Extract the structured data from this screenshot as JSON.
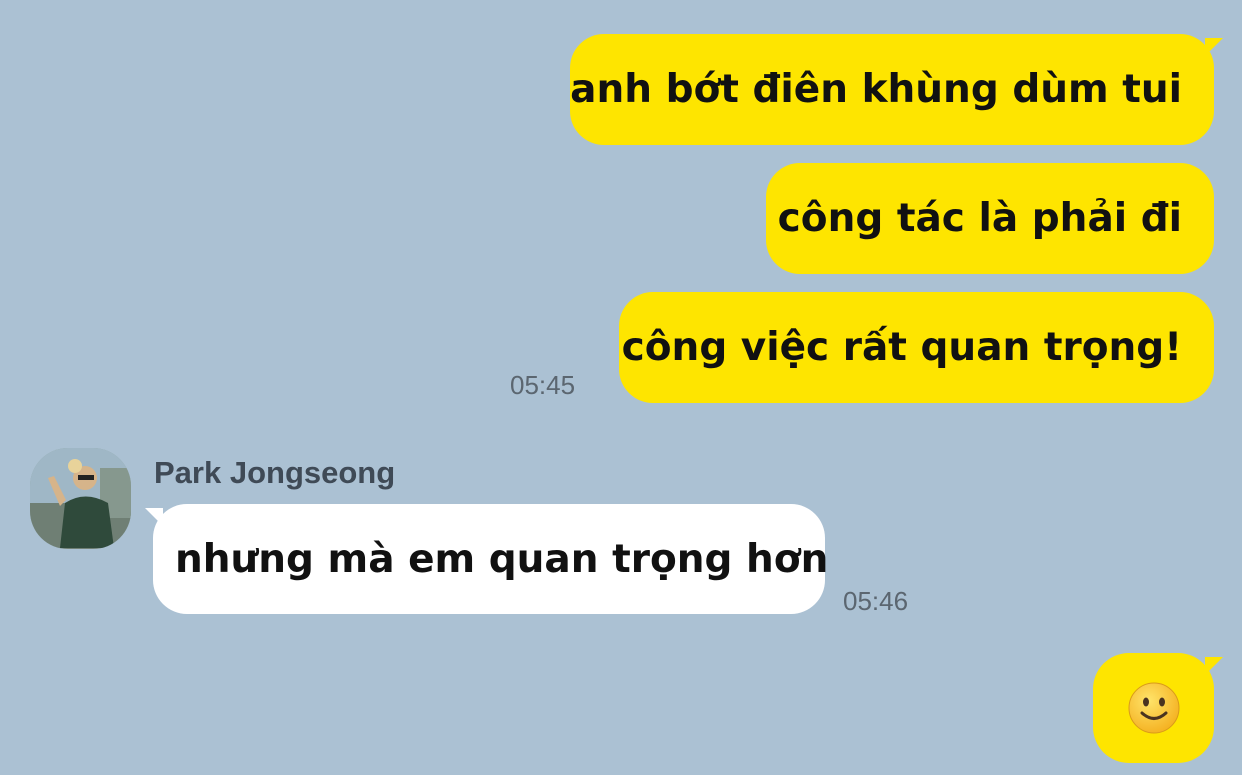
{
  "messages_out_1": "anh bớt điên khùng dùm tui",
  "messages_out_2": "công tác là phải đi",
  "messages_out_3": "công việc rất quan trọng!",
  "time_out_1": "05:45",
  "sender_name": "Park Jongseong",
  "message_in_1": "nhưng mà em quan trọng hơn",
  "time_in_1": "05:46",
  "emoji_icon": "slightly-smiling-face-icon",
  "colors": {
    "background": "#abc1d3",
    "my_bubble": "#fee500",
    "their_bubble": "#ffffff"
  }
}
